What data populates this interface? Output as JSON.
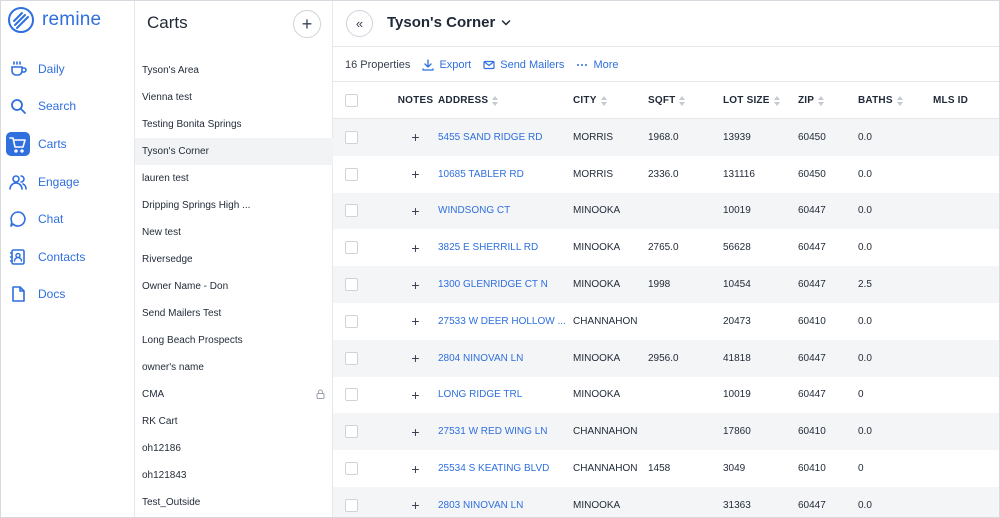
{
  "app": {
    "logo_text": "remine"
  },
  "nav": {
    "items": [
      {
        "label": "Daily",
        "icon": "coffee-icon"
      },
      {
        "label": "Search",
        "icon": "search-icon"
      },
      {
        "label": "Carts",
        "icon": "cart-icon"
      },
      {
        "label": "Engage",
        "icon": "users-icon"
      },
      {
        "label": "Chat",
        "icon": "chat-icon"
      },
      {
        "label": "Contacts",
        "icon": "contacts-icon"
      },
      {
        "label": "Docs",
        "icon": "document-icon"
      }
    ],
    "active": "Carts"
  },
  "carts_panel": {
    "title": "Carts",
    "add_label": "+",
    "items": [
      {
        "label": "Tyson's Area"
      },
      {
        "label": "Vienna test"
      },
      {
        "label": "Testing Bonita Springs"
      },
      {
        "label": "Tyson's Corner",
        "active": true
      },
      {
        "label": "lauren test"
      },
      {
        "label": "Dripping Springs High ..."
      },
      {
        "label": "New test"
      },
      {
        "label": "Riversedge"
      },
      {
        "label": "Owner Name - Don"
      },
      {
        "label": "Send Mailers Test"
      },
      {
        "label": "Long Beach Prospects"
      },
      {
        "label": "owner's name"
      },
      {
        "label": "CMA",
        "locked": true
      },
      {
        "label": "RK Cart"
      },
      {
        "label": "oh12186"
      },
      {
        "label": "oh121843"
      },
      {
        "label": "Test_Outside"
      }
    ]
  },
  "header": {
    "collapse_label": "«",
    "cart_name": "Tyson's Corner"
  },
  "toolbar": {
    "count": "16 Properties",
    "export_label": "Export",
    "send_mailers_label": "Send Mailers",
    "more_label": "More"
  },
  "table": {
    "columns": {
      "notes": "NOTES",
      "address": "ADDRESS",
      "city": "CITY",
      "sqft": "SQFT",
      "lot_size": "LOT SIZE",
      "zip": "ZIP",
      "baths": "BATHS",
      "mls_id": "MLS ID"
    },
    "rows": [
      {
        "address": "5455 SAND RIDGE RD",
        "city": "MORRIS",
        "sqft": "1968.0",
        "lot": "13939",
        "zip": "60450",
        "baths": "0.0",
        "mls": ""
      },
      {
        "address": "10685 TABLER RD",
        "city": "MORRIS",
        "sqft": "2336.0",
        "lot": "131116",
        "zip": "60450",
        "baths": "0.0",
        "mls": ""
      },
      {
        "address": "WINDSONG CT",
        "city": "MINOOKA",
        "sqft": "",
        "lot": "10019",
        "zip": "60447",
        "baths": "0.0",
        "mls": ""
      },
      {
        "address": "3825 E SHERRILL RD",
        "city": "MINOOKA",
        "sqft": "2765.0",
        "lot": "56628",
        "zip": "60447",
        "baths": "0.0",
        "mls": ""
      },
      {
        "address": "1300 GLENRIDGE CT N",
        "city": "MINOOKA",
        "sqft": "1998",
        "lot": "10454",
        "zip": "60447",
        "baths": "2.5",
        "mls": ""
      },
      {
        "address": "27533 W DEER HOLLOW ...",
        "city": "CHANNAHON",
        "sqft": "",
        "lot": "20473",
        "zip": "60410",
        "baths": "0.0",
        "mls": ""
      },
      {
        "address": "2804 NINOVAN LN",
        "city": "MINOOKA",
        "sqft": "2956.0",
        "lot": "41818",
        "zip": "60447",
        "baths": "0.0",
        "mls": ""
      },
      {
        "address": "LONG RIDGE TRL",
        "city": "MINOOKA",
        "sqft": "",
        "lot": "10019",
        "zip": "60447",
        "baths": "0",
        "mls": ""
      },
      {
        "address": "27531 W RED WING LN",
        "city": "CHANNAHON",
        "sqft": "",
        "lot": "17860",
        "zip": "60410",
        "baths": "0.0",
        "mls": ""
      },
      {
        "address": "25534 S KEATING BLVD",
        "city": "CHANNAHON",
        "sqft": "1458",
        "lot": "3049",
        "zip": "60410",
        "baths": "0",
        "mls": ""
      },
      {
        "address": "2803 NINOVAN LN",
        "city": "MINOOKA",
        "sqft": "",
        "lot": "31363",
        "zip": "60447",
        "baths": "0.0",
        "mls": ""
      }
    ]
  },
  "colors": {
    "accent": "#2f6fde",
    "row_alt": "#f4f5f7",
    "border": "#e5e7eb"
  }
}
